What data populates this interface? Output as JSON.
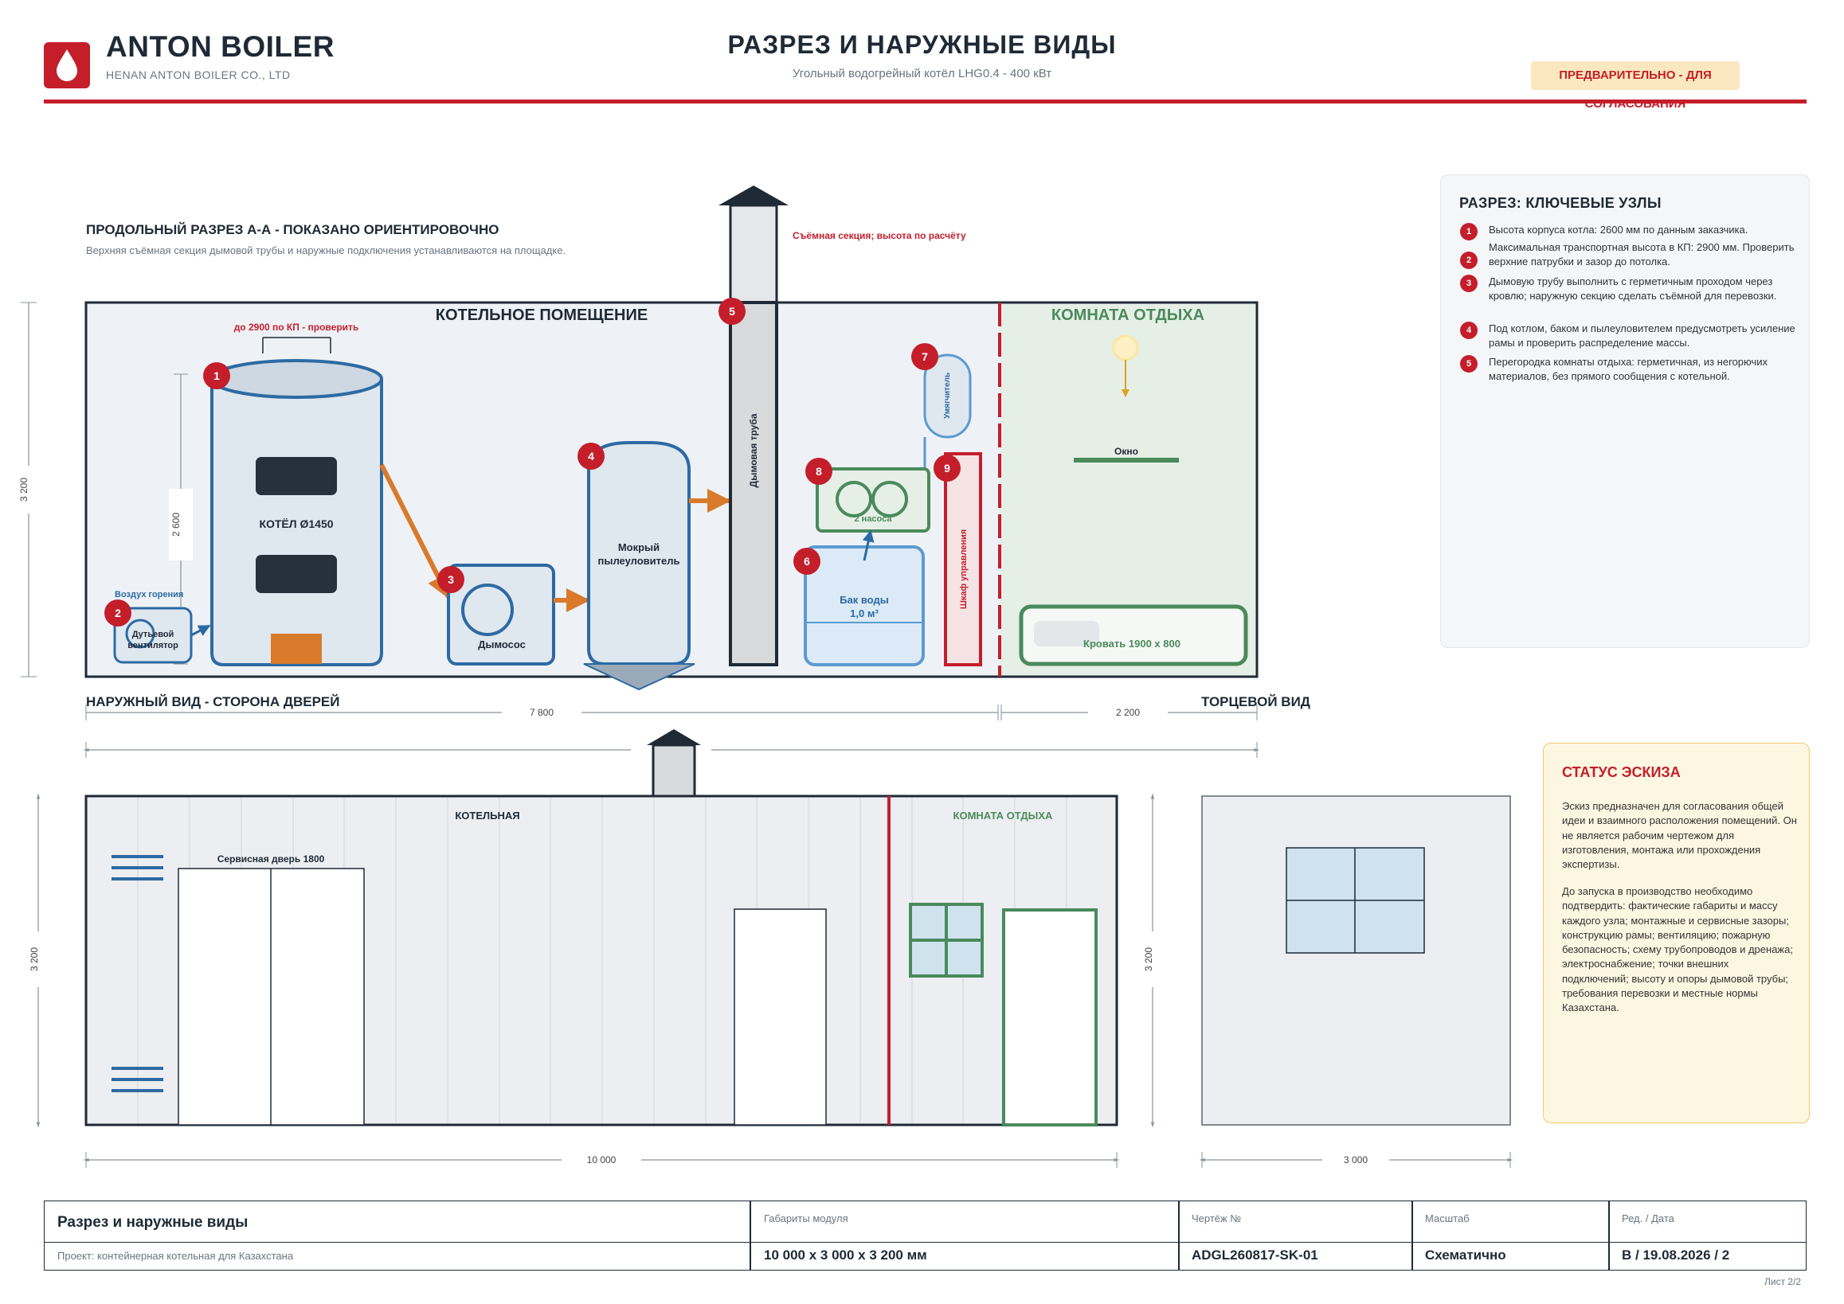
{
  "header": {
    "brand": "ANTON BOILER",
    "brand_sub": "HENAN ANTON BOILER CO., LTD",
    "title": "РАЗРЕЗ И НАРУЖНЫЕ ВИДЫ",
    "subtitle": "Угольный водогрейный котёл LHG0.4 - 400 кВт",
    "badge": "ПРЕДВАРИТЕЛЬНО - ДЛЯ СОГЛАСОВАНИЯ"
  },
  "section": {
    "title": "ПРОДОЛЬНЫЙ РАЗРЕЗ А-А - ПОКАЗАНО ОРИЕНТИРОВОЧНО",
    "note": "Верхняя съёмная секция дымовой трубы и наружные подключения устанавливаются на площадке.",
    "chimney_note": "Съёмная секция; высота по расчёту",
    "boiler_room": "КОТЕЛЬНОЕ ПОМЕЩЕНИЕ",
    "rest_room": "КОМНАТА ОТДЫХА",
    "top_clearance": "до 2900 по КП - проверить",
    "boiler": "КОТЁЛ Ø1450",
    "boiler_height": "2 600",
    "fan_air": "Воздух горения",
    "fan_line1": "Дутьевой",
    "fan_line2": "вентилятор",
    "smoke_fan": "Дымосос",
    "scrubber_line1": "Мокрый",
    "scrubber_line2": "пылеуловитель",
    "chimney": "Дымовая труба",
    "softener": "Умягчитель",
    "pumps": "2 насоса",
    "tank_line1": "Бак воды",
    "tank_line2": "1,0 м³",
    "cabinet": "Шкаф управления",
    "window": "Окно",
    "bed": "Кровать 1900 x 800",
    "height": "3 200",
    "len_boiler": "7 800",
    "len_rest": "2 200"
  },
  "markers": [
    "1",
    "2",
    "3",
    "4",
    "5",
    "6",
    "7",
    "8",
    "9"
  ],
  "views": {
    "front_title": "НАРУЖНЫЙ ВИД - СТОРОНА ДВЕРЕЙ",
    "end_title": "ТОРЦЕВОЙ ВИД",
    "boiler_label": "КОТЕЛЬНАЯ",
    "rest_label": "КОМНАТА ОТДЫХА",
    "service_door": "Сервисная дверь 1800",
    "height": "3 200",
    "length": "10 000",
    "end_height": "3 200",
    "end_width": "3 000"
  },
  "nodes_card": {
    "title": "РАЗРЕЗ: КЛЮЧЕВЫЕ УЗЛЫ",
    "items": [
      {
        "num": "1",
        "text": "Высота корпуса котла: 2600 мм по данным заказчика."
      },
      {
        "num": "2",
        "text": "Максимальная транспортная высота в КП: 2900 мм. Проверить верхние патрубки и зазор до потолка."
      },
      {
        "num": "3",
        "text": "Дымовую трубу выполнить с герметичным проходом через кровлю; наружную секцию сделать съёмной для перевозки."
      },
      {
        "num": "4",
        "text": "Под котлом, баком и пылеуловителем предусмотреть усиление рамы и проверить распределение массы."
      },
      {
        "num": "5",
        "text": "Перегородка комнаты отдыха: герметичная, из негорючих материалов, без прямого сообщения с котельной."
      }
    ]
  },
  "status_card": {
    "title": "СТАТУС ЭСКИЗА",
    "p1": "Эскиз предназначен для согласования общей идеи и взаимного расположения помещений. Он не является рабочим чертежом для изготовления, монтажа или прохождения экспертизы.",
    "p2": "До запуска в производство необходимо подтвердить: фактические габариты и массу каждого узла; монтажные и сервисные зазоры; конструкцию рамы; вентиляцию; пожарную безопасность; схему трубопроводов и дренажа; электроснабжение; точки внешних подключений; высоту и опоры дымовой трубы; требования перевозки и местные нормы Казахстана."
  },
  "title_block": {
    "name": "Разрез и наружные виды",
    "project": "Проект: контейнерная котельная для Казахстана",
    "dims_label": "Габариты модуля",
    "dims": "10 000 x 3 000 x 3 200 мм",
    "drawing_label": "Чертёж №",
    "drawing": "ADGL260817-SK-01",
    "scale_label": "Масштаб",
    "scale": "Схематично",
    "rev_label": "Ред. / Дата",
    "rev": "B / 19.08.2026 / 2",
    "sheet": "Лист 2/2"
  },
  "colors": {
    "accent_red": "#c41e2b",
    "steel_blue": "#2d6aa3",
    "green": "#4a8a5c",
    "orange": "#d97a2b",
    "dark": "#1f2a36"
  },
  "icons": [
    "flame-drop-icon"
  ]
}
